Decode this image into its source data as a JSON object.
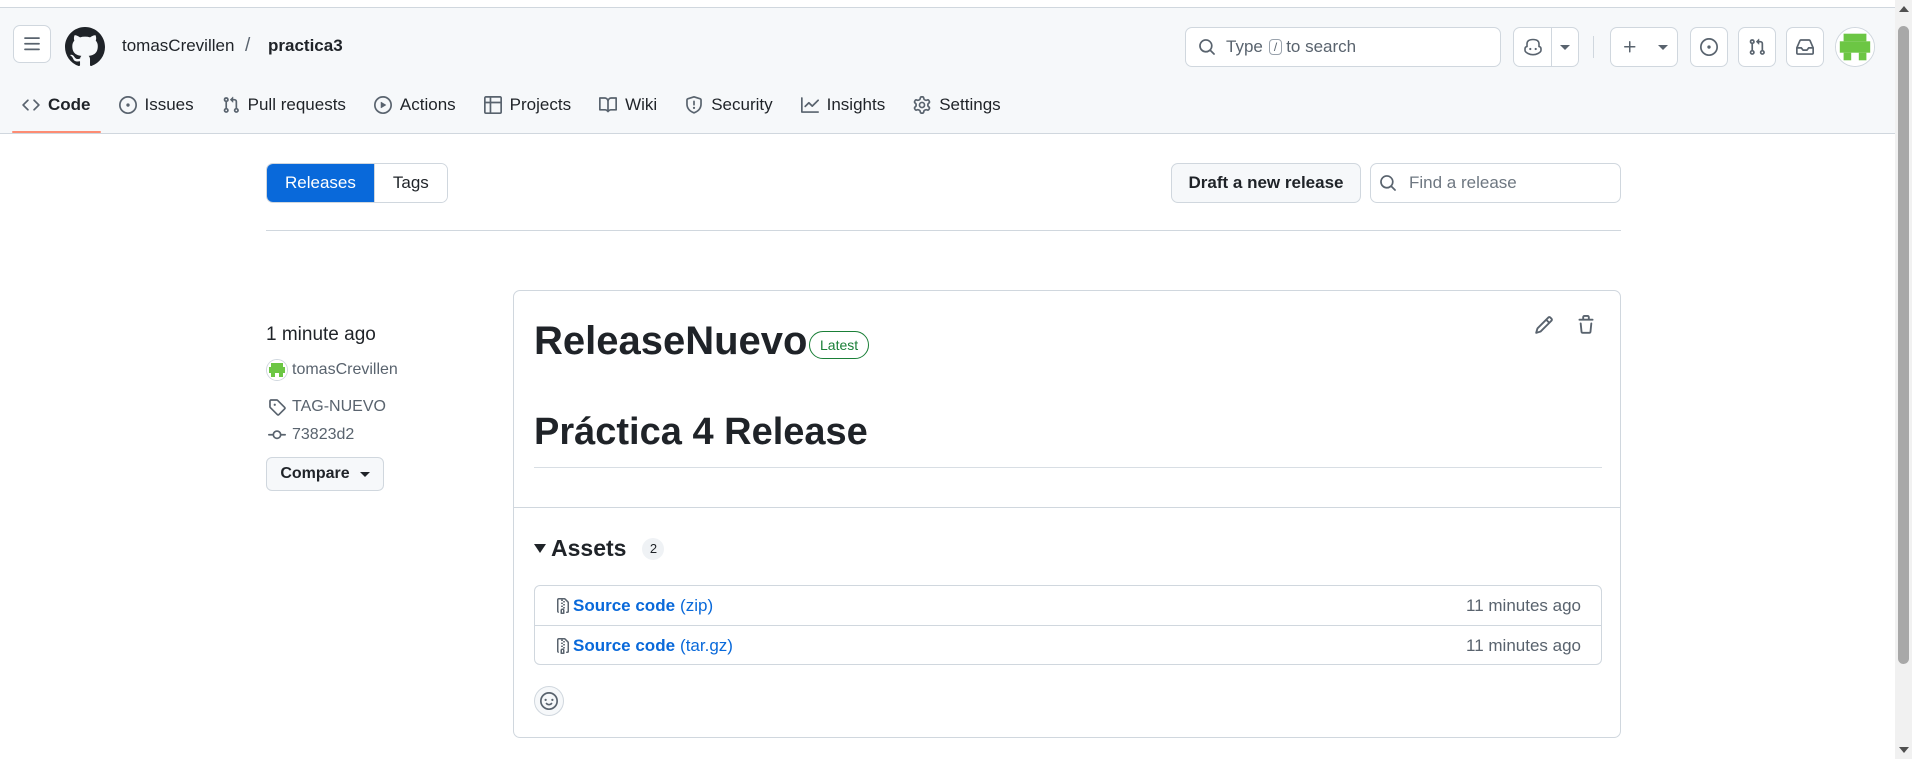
{
  "header": {
    "owner": "tomasCrevillen",
    "separator": "/",
    "repo": "practica3",
    "search": {
      "prefix": "Type",
      "key": "/",
      "suffix": "to search"
    }
  },
  "nav": [
    {
      "label": "Code",
      "icon": "code-icon",
      "active": true
    },
    {
      "label": "Issues",
      "icon": "issue-opened-icon"
    },
    {
      "label": "Pull requests",
      "icon": "git-pull-request-icon"
    },
    {
      "label": "Actions",
      "icon": "play-icon"
    },
    {
      "label": "Projects",
      "icon": "table-icon"
    },
    {
      "label": "Wiki",
      "icon": "book-icon"
    },
    {
      "label": "Security",
      "icon": "shield-icon"
    },
    {
      "label": "Insights",
      "icon": "graph-icon"
    },
    {
      "label": "Settings",
      "icon": "gear-icon"
    }
  ],
  "toolbar": {
    "tabs": {
      "releases": "Releases",
      "tags": "Tags"
    },
    "draft_label": "Draft a new release",
    "find_placeholder": "Find a release"
  },
  "release": {
    "time_ago": "1 minute ago",
    "author": "tomasCrevillen",
    "tag": "TAG-NUEVO",
    "commit": "73823d2",
    "compare_label": "Compare",
    "title": "ReleaseNuevo",
    "badge": "Latest",
    "body_heading": "Práctica 4 Release",
    "assets": {
      "heading": "Assets",
      "count": "2",
      "items": [
        {
          "name": "Source code",
          "ext": "(zip)",
          "time": "11 minutes ago"
        },
        {
          "name": "Source code",
          "ext": "(tar.gz)",
          "time": "11 minutes ago"
        }
      ]
    }
  },
  "colors": {
    "accent": "#0969da",
    "latest_green": "#1a7f37",
    "active_underline": "#fd8c73",
    "avatar_green": "#6cc644"
  }
}
